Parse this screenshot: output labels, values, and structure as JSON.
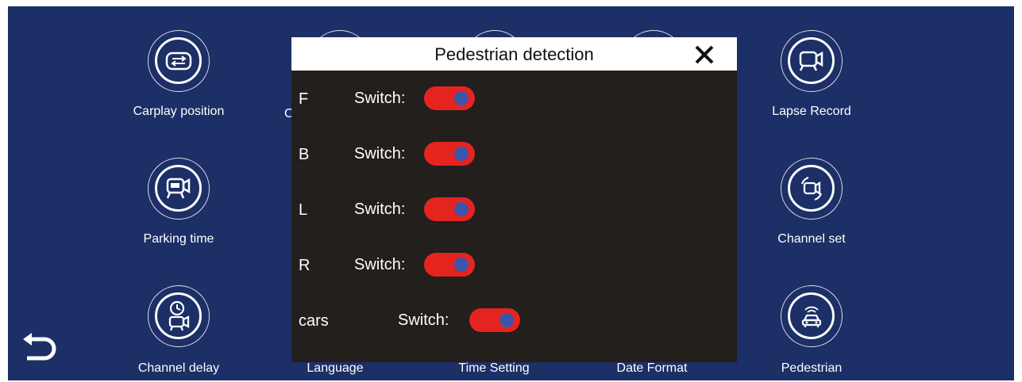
{
  "colors": {
    "screen_bg": "#1c2f66",
    "dialog_bg": "#221f1d",
    "toggle_on": "#e52420",
    "toggle_knob": "#3d55a8"
  },
  "menu": {
    "left_column": [
      {
        "label": "Carplay position",
        "icon": "swap-arrows-icon"
      },
      {
        "label": "Parking time",
        "icon": "parking-camera-icon"
      },
      {
        "label": "Channel delay",
        "icon": "clock-camera-icon"
      }
    ],
    "right_column": [
      {
        "label": "Lapse Record",
        "icon": "camera-record-icon"
      },
      {
        "label": "Channel set",
        "icon": "channel-camera-icon"
      },
      {
        "label": "Pedestrian",
        "icon": "car-sensor-icon"
      }
    ],
    "bottom_labels": [
      "Language",
      "Time Setting",
      "Date Format"
    ],
    "partial_label_char": "C"
  },
  "back_icon": "back-arrow-icon",
  "dialog": {
    "title": "Pedestrian detection",
    "close_icon": "close-icon",
    "rows": [
      {
        "channel": "F",
        "switch_label": "Switch:",
        "on": true
      },
      {
        "channel": "B",
        "switch_label": "Switch:",
        "on": true
      },
      {
        "channel": "L",
        "switch_label": "Switch:",
        "on": true
      },
      {
        "channel": "R",
        "switch_label": "Switch:",
        "on": true
      },
      {
        "channel": "cars",
        "switch_label": "Switch:",
        "on": true
      }
    ]
  }
}
